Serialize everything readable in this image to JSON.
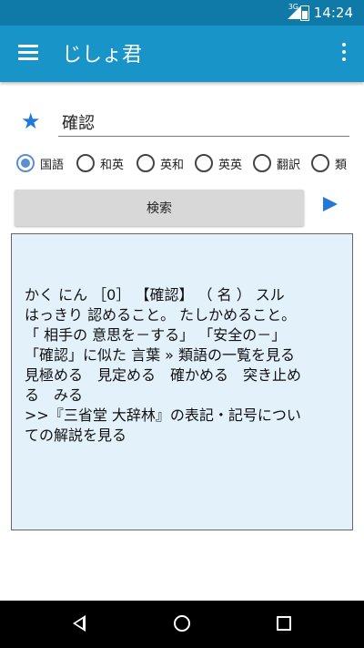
{
  "status_bar": {
    "network": "3G",
    "time": "14:24"
  },
  "app_bar": {
    "title": "じしょ君"
  },
  "search": {
    "value": "確認"
  },
  "dictionaries": [
    {
      "label": "国語",
      "checked": true
    },
    {
      "label": "和英",
      "checked": false
    },
    {
      "label": "英和",
      "checked": false
    },
    {
      "label": "英英",
      "checked": false
    },
    {
      "label": "翻訳",
      "checked": false
    },
    {
      "label": "類",
      "checked": false
    }
  ],
  "search_button": {
    "label": "検索"
  },
  "result": {
    "lines": [
      "かく にん ［0］ 【確認】 （ 名 ） スル",
      "はっきり 認めること。 たしかめること。",
      "「 相手の 意思を－する」 「安全の－」",
      "「確認」に似た 言葉 » 類語の一覧を見る",
      "見極める　見定める　確かめる　突き止め",
      "る　みる",
      " >>『三省堂 大辞林』の表記・記号につい",
      "ての解説を見る"
    ]
  },
  "icons": {
    "menu": "hamburger-icon",
    "overflow": "more-vert-icon",
    "favorite": "star-icon",
    "go": "play-arrow-icon",
    "back": "back-icon",
    "home": "home-icon",
    "recent": "recent-apps-icon"
  },
  "colors": {
    "primary": "#1894c8",
    "status_bar": "#0f7aa8",
    "accent": "#2377d8",
    "result_bg": "#e3f1fb"
  }
}
